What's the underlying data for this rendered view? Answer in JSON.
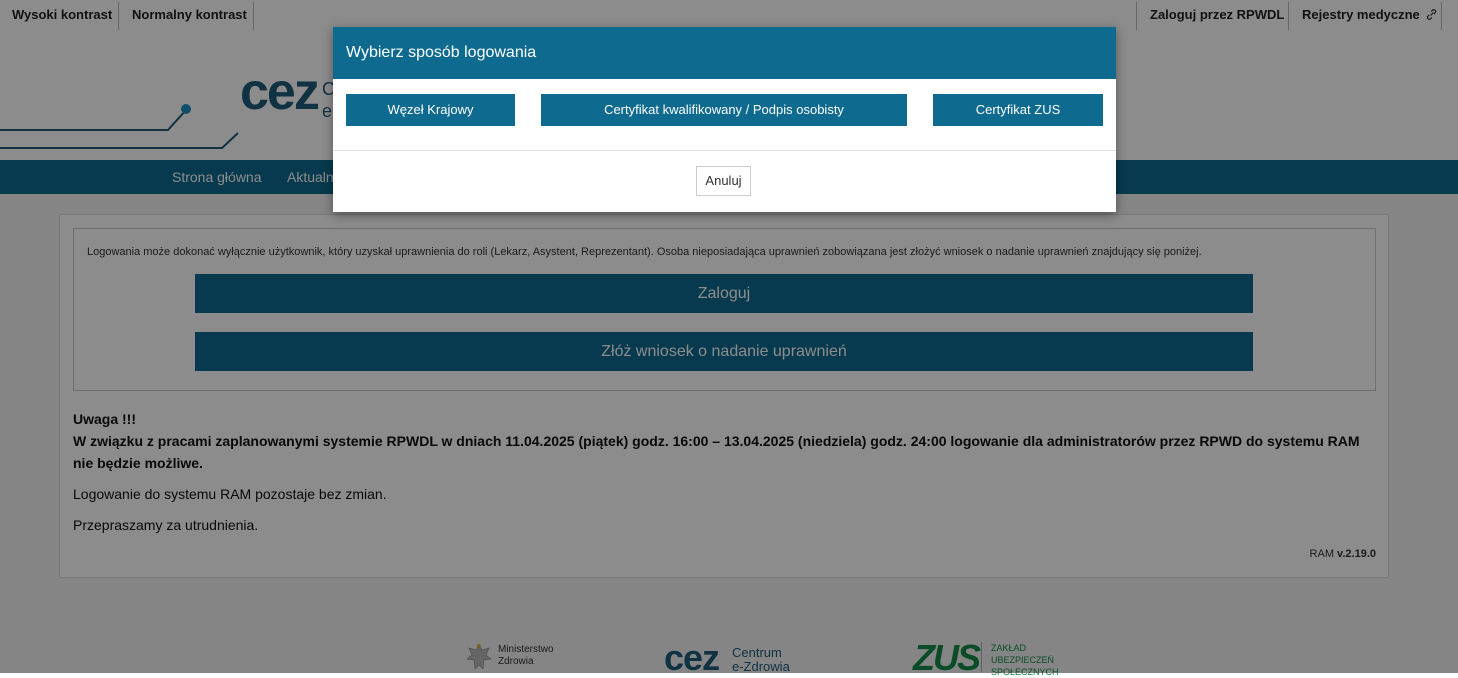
{
  "topbar": {
    "high_contrast": "Wysoki kontrast",
    "normal_contrast": "Normalny kontrast",
    "login_rpwdl": "Zaloguj przez RPWDL",
    "medical_registers": "Rejestry medyczne"
  },
  "header": {
    "logo_text": "cez",
    "logo_side_1": "C",
    "logo_side_2": "e"
  },
  "nav": {
    "items": [
      "Strona główna",
      "Aktualn"
    ]
  },
  "main": {
    "login_info": "Logowania może dokonać wyłącznie użytkownik, który uzyskał uprawnienia do roli (Lekarz, Asystent, Reprezentant). Osoba nieposiadająca uprawnień zobowiązana jest złożyć wniosek o nadanie uprawnień znajdujący się poniżej.",
    "login_button": "Zaloguj",
    "request_button": "Złóż wniosek o nadanie uprawnień",
    "notice_title": "Uwaga !!!",
    "notice_body": "W związku z pracami zaplanowanymi systemie RPWDL w dniach 11.04.2025 (piątek) godz. 16:00 – 13.04.2025 (niedziela) godz. 24:00 logowanie dla administratorów przez RPWD do systemu RAM nie będzie możliwe.",
    "notice_line2": "Logowanie do systemu RAM pozostaje bez zmian.",
    "notice_line3": "Przepraszamy za utrudnienia.",
    "version_prefix": "RAM ",
    "version_value": "v.2.19.0"
  },
  "footer": {
    "ministry_line1": "Ministerstwo",
    "ministry_line2": "Zdrowia",
    "cez_big": "cez",
    "cez_line1": "Centrum",
    "cez_line2": "e-Zdrowia",
    "zus_big": "ZUS",
    "zus_line1": "ZAKŁAD",
    "zus_line2": "UBEZPIECZEŃ",
    "zus_line3": "SPOŁECZNYCH"
  },
  "modal": {
    "title": "Wybierz sposób logowania",
    "buttons": [
      "Węzeł Krajowy",
      "Certyfikat kwalifikowany / Podpis osobisty",
      "Certyfikat ZUS"
    ],
    "cancel": "Anuluj"
  },
  "colors": {
    "primary": "#0e6a8e",
    "logo_blue": "#1f5c7a",
    "logo_green": "#6aa84f",
    "zus_green": "#138a4a"
  },
  "icons": {
    "external_link": "link-icon"
  }
}
